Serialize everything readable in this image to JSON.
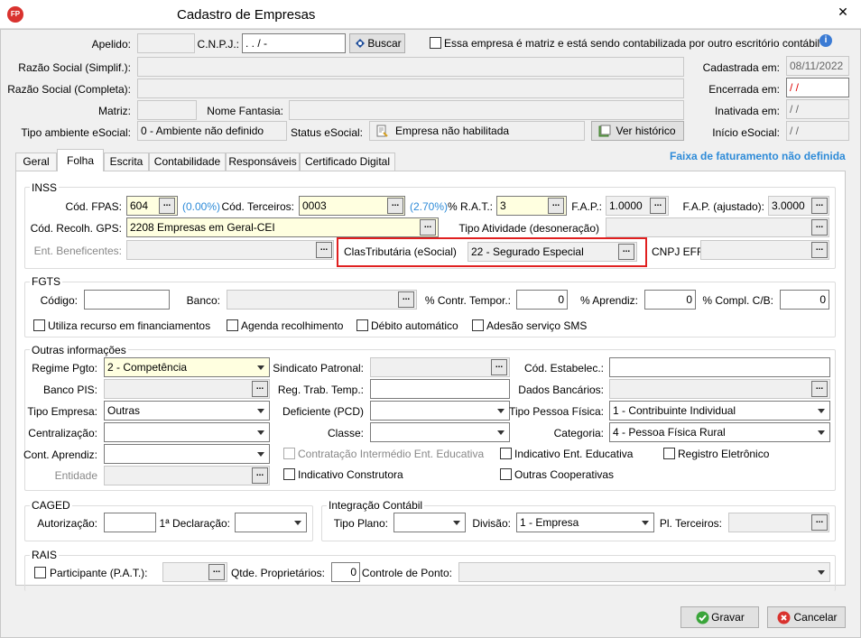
{
  "window": {
    "title": "Cadastro de Empresas",
    "logo": "FP",
    "close_glyph": "✕"
  },
  "header": {
    "apelido_label": "Apelido:",
    "cnpj_label": "C.N.P.J.:",
    "cnpj_value": " .  .  /   -",
    "buscar_label": "Buscar",
    "matriz_check_label": "Essa empresa é matriz e está sendo contabilizada por outro escritório contábil",
    "razao_simpl_label": "Razão Social (Simplif.):",
    "razao_compl_label": "Razão Social (Completa):",
    "matriz_label": "Matriz:",
    "nome_fantasia_label": "Nome Fantasia:",
    "tipo_ambiente_label": "Tipo ambiente eSocial:",
    "tipo_ambiente_value": "0 - Ambiente não definido",
    "status_esocial_label": "Status eSocial:",
    "status_esocial_value": "Empresa não habilitada",
    "ver_historico_label": "Ver histórico",
    "cadastrada_label": "Cadastrada em:",
    "cadastrada_value": "08/11/2022",
    "encerrada_label": "Encerrada em:",
    "encerrada_value": " / /",
    "inativada_label": "Inativada em:",
    "inativada_value": " / /",
    "inicio_label": "Início eSocial:",
    "inicio_value": " / /"
  },
  "tabs": [
    "Geral",
    "Folha",
    "Escrita",
    "Contabilidade",
    "Responsáveis",
    "Certificado Digital"
  ],
  "faixa_text": "Faixa de faturamento não definida",
  "inss": {
    "title": "INSS",
    "fpas_label": "Cód. FPAS:",
    "fpas_value": "604",
    "fpas_pct": "(0.00%)",
    "terceiros_label": "Cód. Terceiros:",
    "terceiros_value": "0003",
    "terceiros_pct": "(2.70%)",
    "rat_label": "% R.A.T.:",
    "rat_value": "3",
    "fap_label": "F.A.P.:",
    "fap_value": "1.0000",
    "fap_aj_label": "F.A.P. (ajustado):",
    "fap_aj_value": "3.0000",
    "gps_label": "Cód. Recolh. GPS:",
    "gps_value": "2208 Empresas em Geral-CEI",
    "tipo_ativ_label": "Tipo Atividade (desoneração)",
    "ent_benef_label": "Ent. Beneficentes:",
    "clas_label": "ClasTributária (eSocial)",
    "clas_value": "22 - Segurado Especial",
    "cnpj_efr_label": "CNPJ EFR"
  },
  "fgts": {
    "title": "FGTS",
    "codigo_label": "Código:",
    "banco_label": "Banco:",
    "contr_tempor_label": "% Contr. Tempor.:",
    "contr_tempor_value": "0",
    "aprendiz_label": "% Aprendiz:",
    "aprendiz_value": "0",
    "compl_label": "% Compl. C/B:",
    "compl_value": "0",
    "chk_financ": "Utiliza recurso em financiamentos",
    "chk_agenda": "Agenda recolhimento",
    "chk_debito": "Débito automático",
    "chk_sms": "Adesão serviço SMS"
  },
  "outras": {
    "title": "Outras informações",
    "regime_label": "Regime Pgto:",
    "regime_value": "2 - Competência",
    "sindicato_label": "Sindicato Patronal:",
    "cod_estab_label": "Cód. Estabelec.:",
    "banco_pis_label": "Banco PIS:",
    "reg_trab_label": "Reg. Trab. Temp.:",
    "dados_banc_label": "Dados Bancários:",
    "tipo_empresa_label": "Tipo Empresa:",
    "tipo_empresa_value": "Outras",
    "deficiente_label": "Deficiente (PCD)",
    "tipo_pf_label": "Tipo Pessoa Física:",
    "tipo_pf_value": "1 - Contribuinte Individual",
    "centralizacao_label": "Centralização:",
    "classe_label": "Classe:",
    "categoria_label": "Categoria:",
    "categoria_value": "4  -  Pessoa Física Rural",
    "cont_aprendiz_label": "Cont. Aprendiz:",
    "chk_contratacao": "Contratação Intermédio Ent. Educativa",
    "chk_ind_ent": "Indicativo Ent. Educativa",
    "chk_registro": "Registro Eletrônico",
    "entidade_label": "Entidade",
    "chk_ind_constr": "Indicativo Construtora",
    "chk_outras_coop": "Outras Cooperativas"
  },
  "caged": {
    "title": "CAGED",
    "autorizacao_label": "Autorização:",
    "declaracao_label": "1ª Declaração:"
  },
  "integracao": {
    "title": "Integração Contábil",
    "tipo_plano_label": "Tipo Plano:",
    "divisao_label": "Divisão:",
    "divisao_value": "1 - Empresa",
    "pl_terceiros_label": "Pl. Terceiros:"
  },
  "rais": {
    "title": "RAIS",
    "participante_label": "Participante (P.A.T.):",
    "qtde_label": "Qtde. Proprietários:",
    "qtde_value": "0",
    "controle_label": "Controle de Ponto:"
  },
  "footer": {
    "gravar_label": "Gravar",
    "cancelar_label": "Cancelar"
  },
  "colors": {
    "accent": "#2e8bd8",
    "highlight_border": "#e02020",
    "yellow_field": "#ffffe0",
    "logo": "#d9322e"
  }
}
